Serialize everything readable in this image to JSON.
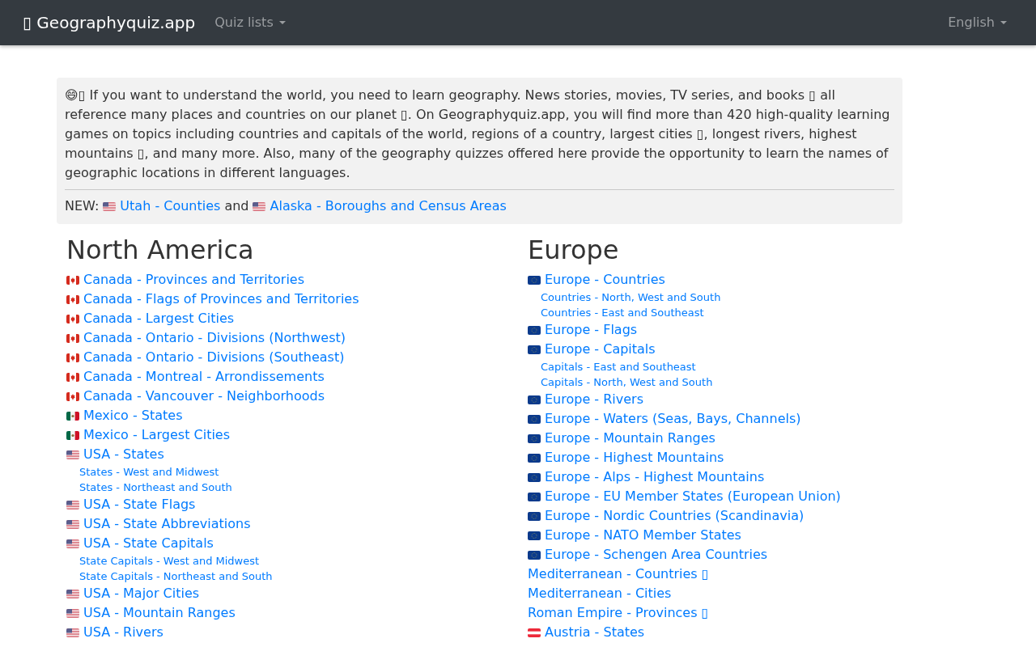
{
  "navbar": {
    "brand": "▯ Geographyquiz.app",
    "menu": {
      "label": "Quiz lists"
    },
    "language": {
      "label": "English"
    }
  },
  "intro": {
    "text": "😄▯ If you want to understand the world, you need to learn geography. News stories, movies, TV series, and books ▯ all reference many places and countries on our planet ▯. On Geographyquiz.app, you will find more than 420 high-quality learning games on topics including countries and capitals of the world, regions of a country, largest cities ▯, longest rivers, highest mountains ▯, and many more. Also, many of the geography quizzes offered here provide the opportunity to learn the names of geographic locations in different languages.",
    "news": {
      "label": "NEW:",
      "joiner": "and",
      "links": [
        {
          "kind": "usa",
          "label": "Utah - Counties"
        },
        {
          "kind": "usa",
          "label": "Alaska - Boroughs and Census Areas"
        }
      ]
    }
  },
  "sections": [
    {
      "title": "North America",
      "items": [
        {
          "kind": "canada",
          "label": "Canada - Provinces and Territories"
        },
        {
          "kind": "canada",
          "label": "Canada - Flags of Provinces and Territories"
        },
        {
          "kind": "canada",
          "label": "Canada - Largest Cities"
        },
        {
          "kind": "canada",
          "label": "Canada - Ontario - Divisions (Northwest)"
        },
        {
          "kind": "canada",
          "label": "Canada - Ontario - Divisions (Southeast)"
        },
        {
          "kind": "canada",
          "label": "Canada - Montreal - Arrondissements"
        },
        {
          "kind": "canada",
          "label": "Canada - Vancouver - Neighborhoods"
        },
        {
          "kind": "mexico",
          "label": "Mexico - States"
        },
        {
          "kind": "mexico",
          "label": "Mexico - Largest Cities"
        },
        {
          "kind": "usa",
          "label": "USA - States",
          "children": [
            {
              "label": "States - West and Midwest"
            },
            {
              "label": "States - Northeast and South"
            }
          ]
        },
        {
          "kind": "usa",
          "label": "USA - State Flags"
        },
        {
          "kind": "usa",
          "label": "USA - State Abbreviations"
        },
        {
          "kind": "usa",
          "label": "USA - State Capitals",
          "children": [
            {
              "label": "State Capitals - West and Midwest"
            },
            {
              "label": "State Capitals - Northeast and South"
            }
          ]
        },
        {
          "kind": "usa",
          "label": "USA - Major Cities"
        },
        {
          "kind": "usa",
          "label": "USA - Mountain Ranges"
        },
        {
          "kind": "usa",
          "label": "USA - Rivers"
        }
      ]
    },
    {
      "title": "Europe",
      "items": [
        {
          "kind": "eu",
          "label": "Europe - Countries",
          "children": [
            {
              "label": "Countries - North, West and South"
            },
            {
              "label": "Countries - East and Southeast"
            }
          ]
        },
        {
          "kind": "eu",
          "label": "Europe - Flags"
        },
        {
          "kind": "eu",
          "label": "Europe - Capitals",
          "children": [
            {
              "label": "Capitals - East and Southeast"
            },
            {
              "label": "Capitals - North, West and South"
            }
          ]
        },
        {
          "kind": "eu",
          "label": "Europe - Rivers"
        },
        {
          "kind": "eu",
          "label": "Europe - Waters (Seas, Bays, Channels)"
        },
        {
          "kind": "eu",
          "label": "Europe - Mountain Ranges"
        },
        {
          "kind": "eu",
          "label": "Europe - Highest Mountains"
        },
        {
          "kind": "eu",
          "label": "Europe - Alps - Highest Mountains"
        },
        {
          "kind": "eu",
          "label": "Europe - EU Member States (European Union)"
        },
        {
          "kind": "eu",
          "label": "Europe - Nordic Countries (Scandinavia)"
        },
        {
          "kind": "eu",
          "label": "Europe - NATO Member States"
        },
        {
          "kind": "eu",
          "label": "Europe - Schengen Area Countries"
        },
        {
          "kind": "plain",
          "label": "Mediterranean - Countries ▯"
        },
        {
          "kind": "plain",
          "label": "Mediterranean - Cities"
        },
        {
          "kind": "plain",
          "label": "Roman Empire - Provinces ▯"
        },
        {
          "kind": "austria",
          "label": "Austria - States"
        }
      ]
    }
  ]
}
